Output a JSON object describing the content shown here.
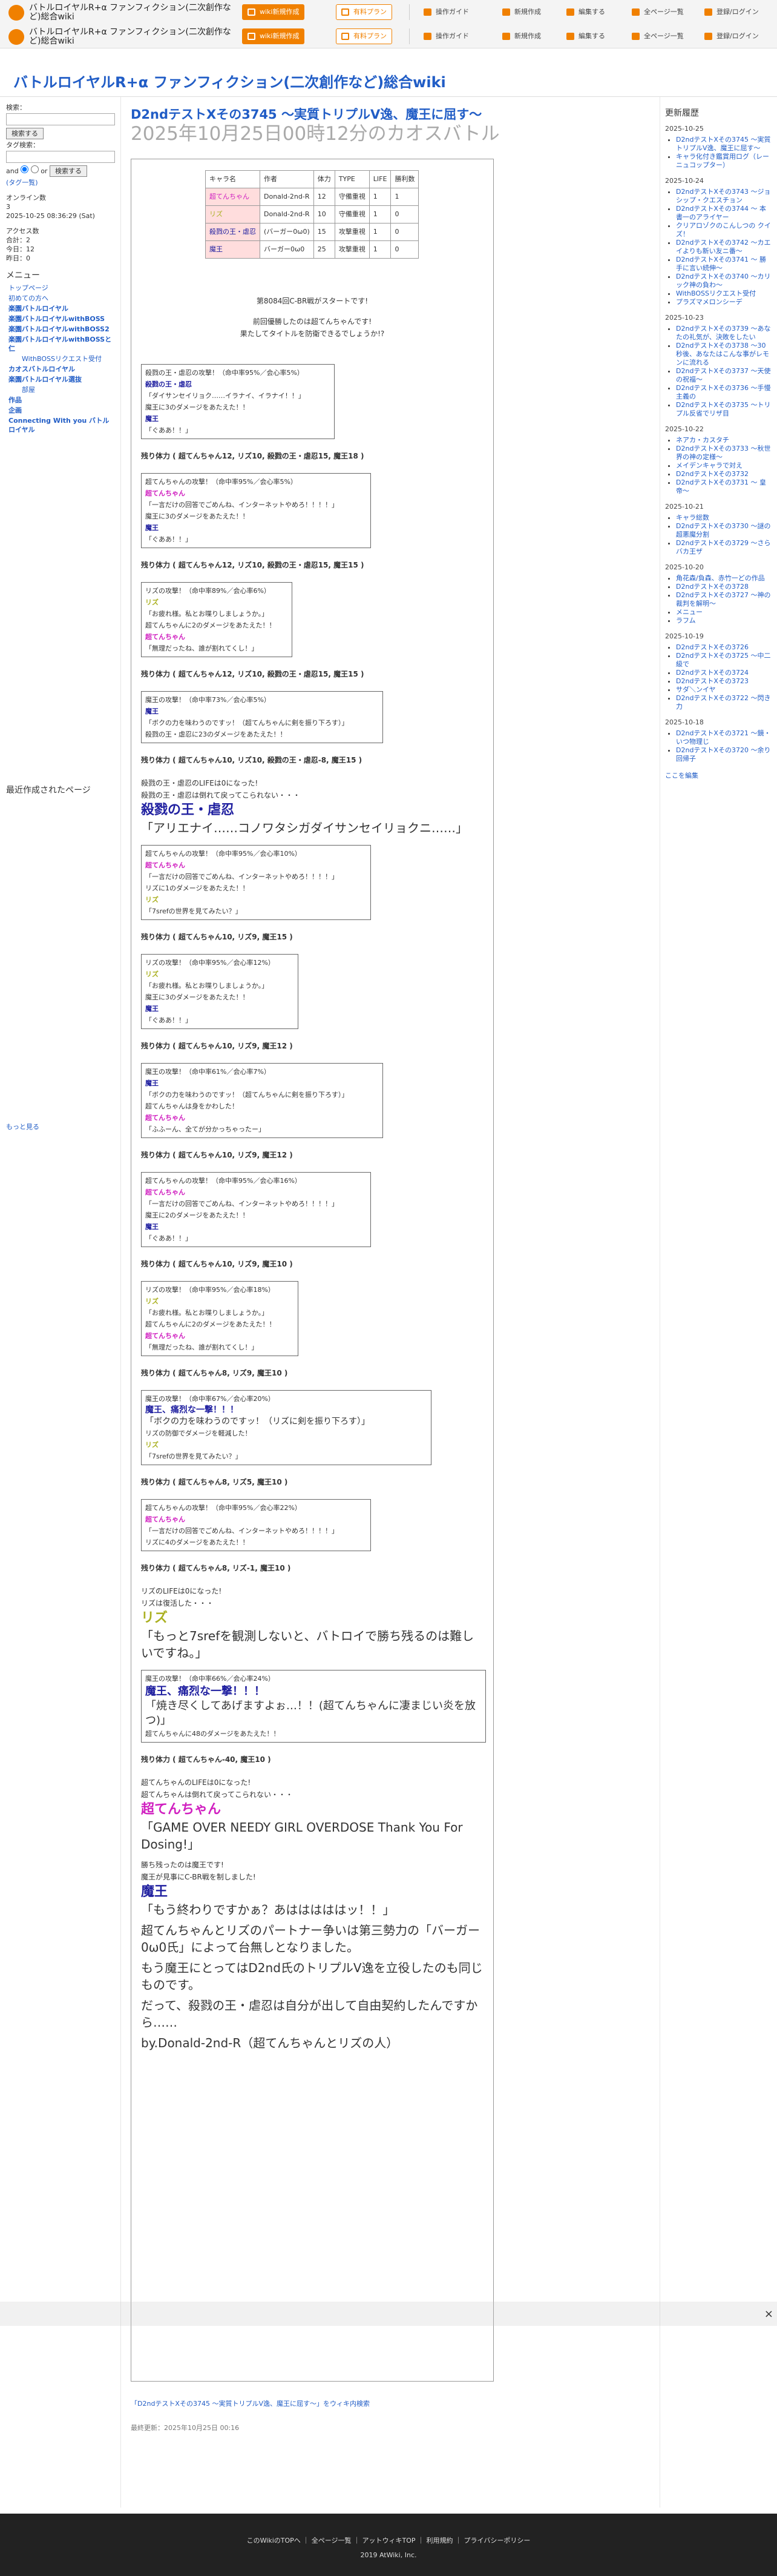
{
  "topbar": {
    "site_title": "バトルロイヤルR+α ファンフィクション(二次創作など)総合wiki",
    "btn_wiki_new": "wiki新規作成",
    "btn_paid": "有料プラン",
    "nav_guide": "操作ガイド",
    "nav_new": "新規作成",
    "nav_edit": "編集する",
    "nav_all": "全ページ一覧",
    "nav_login": "登録/ログイン"
  },
  "header": {
    "title": "バトルロイヤルR+α ファンフィクション(二次創作など)総合wiki"
  },
  "leftnav": {
    "search_label": "検索：",
    "search_btn": "検索する",
    "tag_label": "タグ検索：",
    "and_label": "and",
    "or_label": "or",
    "tag_btn": "検索する",
    "tag_list": "(タグ一覧)",
    "online_title": "オンライン数",
    "online_count": "3",
    "datetime": "2025-10-25 08:36:29 (Sat)",
    "access_title": "アクセス数",
    "access_total": "合計：2",
    "access_today": "今日：12",
    "access_yesterday": "昨日：0",
    "menu_title": "メニュー",
    "menu_items": [
      "トップページ",
      "初めての方へ",
      "楽園バトルロイヤル",
      "楽園バトルロイヤルwithBOSS",
      "楽園バトルロイヤルwithBOSS2",
      "楽園バトルロイヤルwithBOSSと仁",
      "WithBOSSリクエスト受付",
      "カオスバトルロイヤル",
      "楽園バトルロイヤル選抜",
      "部屋",
      "作品",
      "企画",
      "Connecting With you バトルロイヤル"
    ],
    "recent_title": "最近作成されたページ",
    "recent_more": "もっと見る"
  },
  "main": {
    "title": "D2ndテストXその3745 〜実質トリプルV逸、魔王に屈す〜",
    "subtitle": "2025年10月25日00時12分のカオスバトル"
  },
  "table": {
    "headers": [
      "キャラ名",
      "作者",
      "体力",
      "TYPE",
      "LIFE",
      "勝利数"
    ],
    "rows": [
      [
        "超てんちゃん",
        "Donald-2nd-R",
        "12",
        "守備重視",
        "1",
        "1"
      ],
      [
        "リズ",
        "Donald-2nd-R",
        "10",
        "守備重視",
        "1",
        "0"
      ],
      [
        "殺戮の王・虐忍",
        "(バーガー0ω0)",
        "15",
        "攻撃重視",
        "1",
        "0"
      ],
      [
        "魔王",
        "バーガー0ω0",
        "25",
        "攻撃重視",
        "1",
        "0"
      ]
    ]
  },
  "story": {
    "start": "第8084回C-BR戦がスタートです!",
    "intro1": "前回優勝したのは超てんちゃんです!",
    "intro2": "果たしてタイトルを防衛できるでしょうか!?",
    "hp1": "残り体力 ( 超てんちゃん12, リズ10, 殺戮の王・虐忍15, 魔王18 )",
    "hp2": "残り体力 ( 超てんちゃん12, リズ10, 殺戮の王・虐忍15, 魔王15 )",
    "hp3": "残り体力 ( 超てんちゃん12, リズ10, 殺戮の王・虐忍15, 魔王15 )",
    "hp4": "残り体力 ( 超てんちゃん10, リズ10, 殺戮の王・虐忍-8, 魔王15 )",
    "death1": "殺戮の王・虐忍のLIFEは0になった!",
    "death2": "殺戮の王・虐忍は倒れて戻ってこられない・・・",
    "big1a": "殺戮の王・虐忍",
    "big1b": "「アリエナイ……コノワタシガダイサンセイリョクニ……」",
    "hp5": "残り体力 ( 超てんちゃん10, リズ9, 魔王15 )",
    "hp6": "残り体力 ( 超てんちゃん10, リズ9, 魔王12 )",
    "hp7": "残り体力 ( 超てんちゃん10, リズ9, 魔王12 )",
    "hp8": "残り体力 ( 超てんちゃん10, リズ9, 魔王10 )",
    "hp9": "残り体力 ( 超てんちゃん8, リズ9, 魔王10 )",
    "hp10": "残り体力 ( 超てんちゃん8, リズ5, 魔王10 )",
    "hp11": "残り体力 ( 超てんちゃん8, リズ-1, 魔王10 )",
    "liz_d1": "リズのLIFEは0になった!",
    "liz_d2": "リズは復活した・・・",
    "big2a": "リズ",
    "big2b": "「もっと7srefを観測しないと、バトロイで勝ち残るのは難しいですね。」",
    "hp12": "残り体力 ( 超てんちゃん-40, 魔王10 )",
    "ten_d1": "超てんちゃんのLIFEは0になった!",
    "ten_d2": "超てんちゃんは倒れて戻ってこられない・・・",
    "big3a": "超てんちゃん",
    "big3b": "「GAME OVER NEEDY GIRL OVERDOSE Thank You For Dosing!」",
    "win1": "勝ち残ったのは魔王です!",
    "win2": "魔王が見事にC-BR戦を制しました!",
    "big4a": "魔王",
    "big4b": "「もう終わりですかぁ？あはははははッ！！」",
    "end1": "超てんちゃんとリズのパートナー争いは第三勢力の「バーガー0ω0氏」によって台無しとなりました。",
    "end2": "もう魔王にとってはD2nd氏のトリプルV逸を立役したのも同じものです。",
    "end3": "だって、殺戮の王・虐忍は自分が出して自由契約したんですから……",
    "end4": "by.Donald-2nd-R（超てんちゃんとリズの人）"
  },
  "messages": [
    {
      "head": "殺戮の王・虐忍の攻撃！（命中率95%／会心率5%）",
      "who": "殺戮の王・虐忍",
      "line": "「ダイサンセイリョク……イラナイ、イラナイ！！」",
      "dmg": "魔王に3のダメージをあたえた！！",
      "who2": "魔王",
      "line2": "「ぐああ！！」"
    },
    {
      "head": "超てんちゃんの攻撃！（命中率95%／会心率5%）",
      "who": "超てんちゃん",
      "line": "「一言だけの回答でごめんね、インターネットやめろ！！！！」",
      "dmg": "魔王に3のダメージをあたえた！！",
      "who2": "魔王",
      "line2": "「ぐああ！！」"
    },
    {
      "head": "リズの攻撃！（命中率89%／会心率6%）",
      "who": "リズ",
      "line": "「お疲れ様。私とお喋りしましょうか。」",
      "dmg": "超てんちゃんに2のダメージをあたえた！！",
      "who2": "超てんちゃん",
      "line2": "「無理だったね、誰が割れてくし！」"
    },
    {
      "head": "魔王の攻撃！（命中率73%／会心率5%）",
      "who": "魔王",
      "line": "「ボクの力を味わうのですッ！（超てんちゃんに剣を振り下ろす）」",
      "dmg": "殺戮の王・虐忍に23のダメージをあたえた！！",
      "who2": "",
      "line2": ""
    },
    {
      "head": "超てんちゃんの攻撃！（命中率95%／会心率10%）",
      "who": "超てんちゃん",
      "line": "「一言だけの回答でごめんね、インターネットやめろ！！！！」",
      "dmg": "リズに1のダメージをあたえた！！",
      "who2": "リズ",
      "line2": "「7srefの世界を見てみたい？」"
    },
    {
      "head": "リズの攻撃！（命中率95%／会心率12%）",
      "who": "リズ",
      "line": "「お疲れ様。私とお喋りしましょうか。」",
      "dmg": "魔王に3のダメージをあたえた！！",
      "who2": "魔王",
      "line2": "「ぐああ！！」"
    },
    {
      "head": "魔王の攻撃！（命中率61%／会心率7%）",
      "who": "魔王",
      "line": "「ボクの力を味わうのですッ！（超てんちゃんに剣を振り下ろす）」",
      "dmg": "超てんちゃんは身をかわした！",
      "who2": "超てんちゃん",
      "line2": "「ふふーん、全てが分かっちゃったー」"
    },
    {
      "head": "超てんちゃんの攻撃！（命中率95%／会心率16%）",
      "who": "超てんちゃん",
      "line": "「一言だけの回答でごめんね、インターネットやめろ！！！！」",
      "dmg": "魔王に2のダメージをあたえた！！",
      "who2": "魔王",
      "line2": "「ぐああ！！」"
    },
    {
      "head": "リズの攻撃！（命中率95%／会心率18%）",
      "who": "リズ",
      "line": "「お疲れ様。私とお喋りしましょうか。」",
      "dmg": "超てんちゃんに2のダメージをあたえた！！",
      "who2": "超てんちゃん",
      "line2": "「無理だったね、誰が割れてくし！」"
    },
    {
      "head": "魔王の攻撃！（命中率67%／会心率20%）",
      "who": "魔王、痛烈な一撃！！！",
      "line": "「ボクの力を味わうのですッ！（リズに剣を振り下ろす）」",
      "dmg": "リズの防御でダメージを軽減した！",
      "who2": "リズ",
      "line2": "「7srefの世界を見てみたい？」"
    },
    {
      "head": "超てんちゃんの攻撃！（命中率95%／会心率22%）",
      "who": "超てんちゃん",
      "line": "「一言だけの回答でごめんね、インターネットやめろ！！！！」",
      "dmg": "リズに4のダメージをあたえた！！",
      "who2": "",
      "line2": ""
    },
    {
      "head": "魔王の攻撃！（命中率66%／会心率24%）",
      "who": "魔王、痛烈な一撃！！！",
      "line": "「焼き尽くしてあげますよぉ…！！(超てんちゃんに凄まじい炎を放つ)」",
      "dmg": "超てんちゃんに48のダメージをあたえた！！",
      "who2": "",
      "line2": ""
    }
  ],
  "rightnav": {
    "title": "更新履歴",
    "groups": [
      {
        "date": "2025-10-25",
        "items": [
          "D2ndテストXその3745 〜実質トリプルV逸、魔王に屈す〜",
          "キャラ化付き鑑賞用ログ（レーニュコップター）"
        ]
      },
      {
        "date": "2025-10-24",
        "items": [
          "D2ndテストXその3743 〜ジョシップ・クエスチョン",
          "D2ndテストXその3744 〜 本 書一のアライヤー",
          "クリアロゾクのこんしつの クイズ！",
          "D2ndテストXその3742 〜カエイよりも新い友ニ番〜",
          "D2ndテストXその3741 〜 勝手に言い続伸〜",
          "D2ndテストXその3740 〜カリック神の負わ〜",
          "WithBOSSリクエスト受付",
          "プラズマメロンシーデ"
        ]
      },
      {
        "date": "2025-10-23",
        "items": [
          "D2ndテストXその3739 〜あなたの礼気が、決敗をしたい",
          "D2ndテストXその3738 〜30秒後、あなたはこんな事がレモンに流れる",
          "D2ndテストXその3737 〜天使の祝福〜",
          "D2ndテストXその3736 〜手慢主義の",
          "D2ndテストXその3735 〜トリプル反省でリザ目"
        ]
      },
      {
        "date": "2025-10-22",
        "items": [
          "ネアカ・カスタチ",
          "D2ndテストXその3733 〜秋世界の神の定様〜",
          "メイデンキャラで対え",
          "D2ndテストXその3732",
          "D2ndテストXその3731 〜 皇帝〜"
        ]
      },
      {
        "date": "2025-10-21",
        "items": [
          "キャラ総数",
          "D2ndテストXその3730 〜謎の超悪魔分割",
          "D2ndテストXその3729 〜さらバカ王ザ"
        ]
      },
      {
        "date": "2025-10-20",
        "items": [
          "角花森/負森、赤竹一どの作品",
          "D2ndテストXその3728",
          "D2ndテストXその3727 〜神の裁判を解明〜",
          "メニュー",
          "ラフム"
        ]
      },
      {
        "date": "2025-10-19",
        "items": [
          "D2ndテストXその3726",
          "D2ndテストXその3725 〜中二級で",
          "D2ndテストXその3724",
          "D2ndテストXその3723",
          "サダ＼ンイヤ",
          "D2ndテストXその3722 〜閃き力"
        ]
      },
      {
        "date": "2025-10-18",
        "items": [
          "D2ndテストXその3721 〜鏡・いつ物理じ",
          "D2ndテストXその3720 〜余り回帰子"
        ]
      }
    ],
    "edit_link": "ここを編集"
  },
  "footer": {
    "links": "このWikiのTOPへ ｜ 全ページ一覧 ｜ アットウィキTOP ｜ 利用規約 ｜ プライバシーポリシー",
    "copy": "2019 AtWiki, Inc."
  },
  "tagline": "「D2ndテストXその3745 〜実質トリプルV逸、魔王に屈す〜」をウィキ内検索",
  "modified": "最終更新：2025年10月25日 00:16",
  "ad_close": "×"
}
